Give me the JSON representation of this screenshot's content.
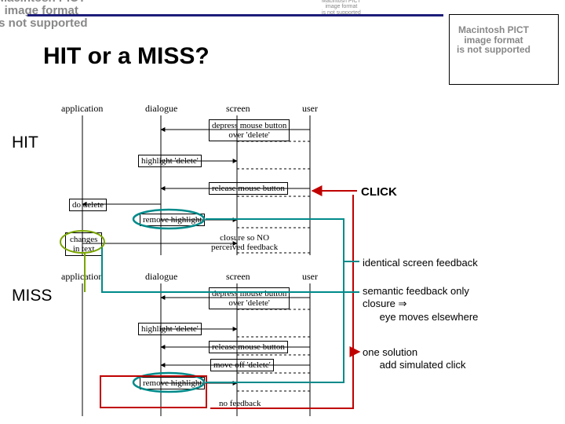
{
  "title": "HIT or a MISS?",
  "side": {
    "hit": "HIT",
    "miss": "MISS"
  },
  "actors": {
    "app": "application",
    "dlg": "dialogue",
    "scr": "screen",
    "usr": "user"
  },
  "click": "CLICK",
  "notes": {
    "isf": "identical screen feedback",
    "sfo1": "semantic feedback only",
    "sfo2a": "closure ",
    "sfo2b": "⇒",
    "sfo3": "eye moves elsewhere",
    "sol1": "one solution",
    "sol2": "add simulated click"
  },
  "hit": {
    "b1": "depress mouse button\nover 'delete'",
    "b2": "highlight 'delete'",
    "b3": "release mouse button",
    "b4": "do delete",
    "b5": "remove highlight",
    "b6": "changes\nin text",
    "b7": "closure so NO\nperceived feedback"
  },
  "miss": {
    "b1": "depress mouse button\nover 'delete'",
    "b2": "highlight 'delete'",
    "b3": "release mouse button",
    "b4": "move off 'delete'",
    "b5": "remove highlight",
    "b6": "no feedback"
  },
  "pict": {
    "l1": "Macintosh PICT",
    "l2": "image format",
    "l3": "is not supported"
  }
}
